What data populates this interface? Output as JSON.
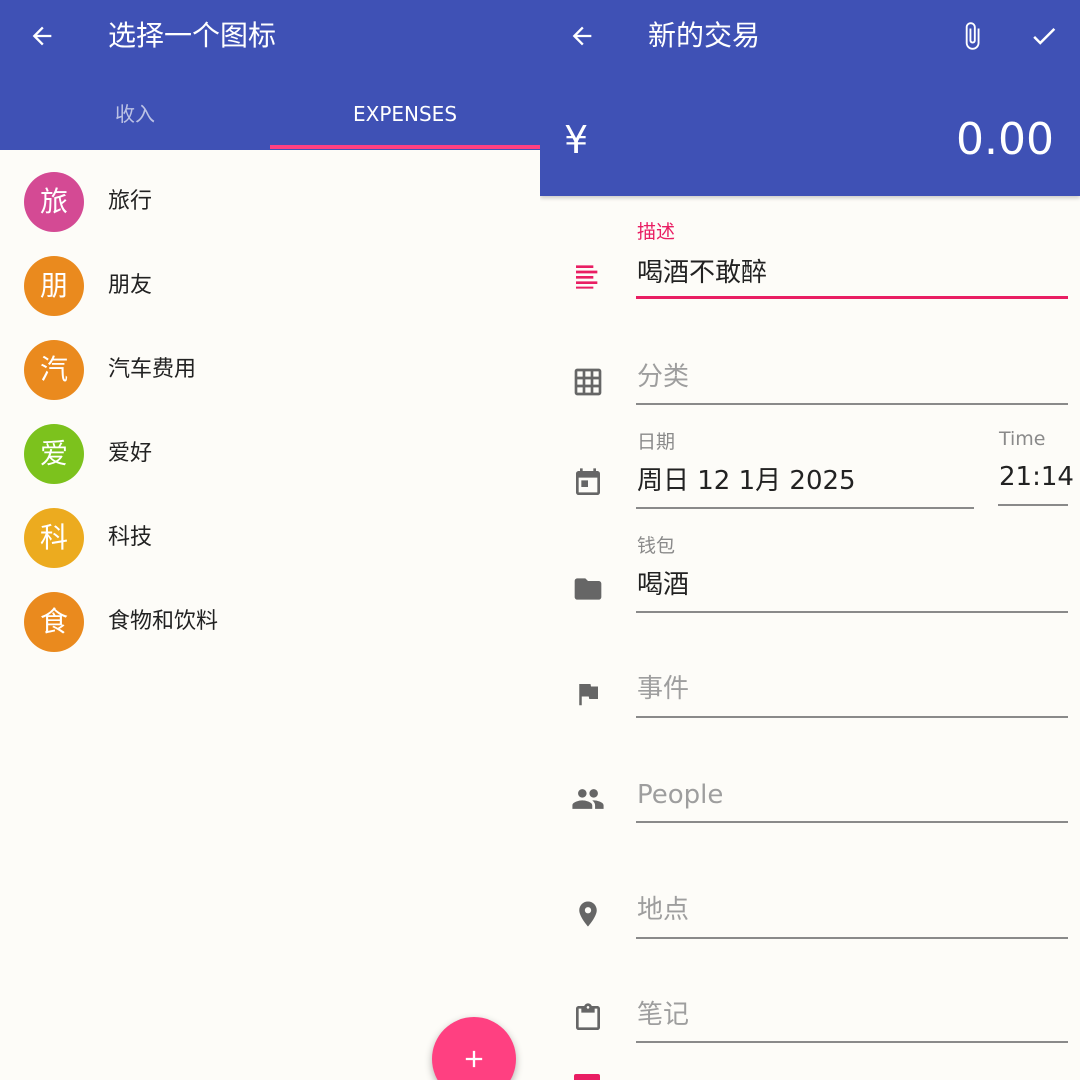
{
  "left": {
    "title": "选择一个图标",
    "tabs": [
      {
        "label": "收入",
        "active": false
      },
      {
        "label": "EXPENSES",
        "active": true
      }
    ],
    "categories": [
      {
        "glyph": "旅",
        "label": "旅行",
        "color": "#d44a94"
      },
      {
        "glyph": "朋",
        "label": "朋友",
        "color": "#ea8a1e"
      },
      {
        "glyph": "汽",
        "label": "汽车费用",
        "color": "#ea8a1e"
      },
      {
        "glyph": "爱",
        "label": "爱好",
        "color": "#7cc21d"
      },
      {
        "glyph": "科",
        "label": "科技",
        "color": "#ecab1f"
      },
      {
        "glyph": "食",
        "label": "食物和饮料",
        "color": "#ea8a1e"
      }
    ],
    "fab_icon": "plus-icon"
  },
  "right": {
    "title": "新的交易",
    "currency_symbol": "¥",
    "amount": "0.00",
    "fields": {
      "description": {
        "label": "描述",
        "value": "喝酒不敢醉",
        "icon": "notes-icon"
      },
      "category": {
        "placeholder": "分类",
        "icon": "grid-icon"
      },
      "date": {
        "label": "日期",
        "value": "周日 12 1月 2025",
        "icon": "calendar-icon"
      },
      "time": {
        "label": "Time",
        "value": "21:14"
      },
      "wallet": {
        "label": "钱包",
        "value": "喝酒",
        "icon": "folder-icon"
      },
      "event": {
        "placeholder": "事件",
        "icon": "flag-icon"
      },
      "people": {
        "placeholder": "People",
        "icon": "people-icon"
      },
      "place": {
        "placeholder": "地点",
        "icon": "location-icon"
      },
      "note": {
        "placeholder": "笔记",
        "icon": "clipboard-icon"
      }
    }
  },
  "colors": {
    "primary": "#3f51b5",
    "accent": "#ff4081",
    "active_field": "#e91e63"
  }
}
